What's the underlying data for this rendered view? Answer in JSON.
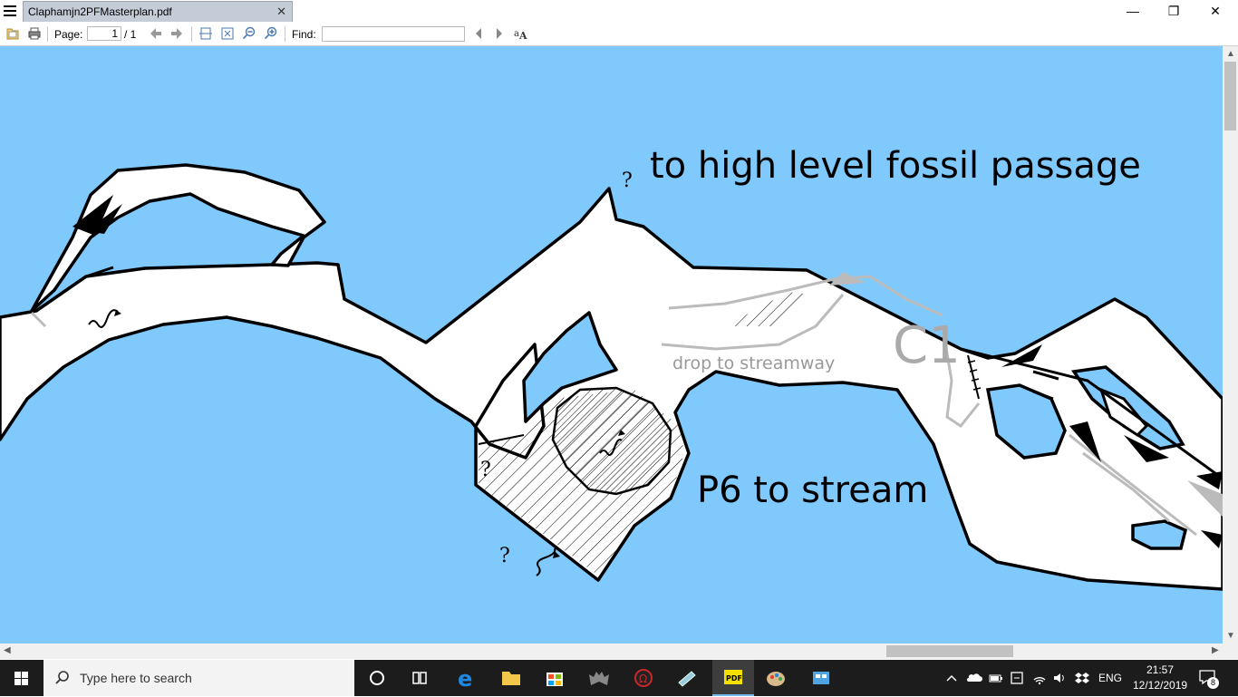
{
  "window": {
    "tab_title": "Claphamjn2PFMasterplan.pdf",
    "tab_close": "✕",
    "minimize": "—",
    "restore": "❐",
    "close": "✕"
  },
  "toolbar": {
    "page_label": "Page:",
    "page_value": "1",
    "page_total": "/ 1",
    "find_label": "Find:",
    "find_value": ""
  },
  "document": {
    "label_fossil": "to high level fossil passage",
    "label_p6": "P6 to stream",
    "label_drop": "drop to streamway",
    "label_c1": "C1",
    "question_marks": [
      "?",
      "?",
      "?"
    ],
    "colors": {
      "water": "#80c9fd",
      "passage": "#ffffff",
      "outline": "#000000",
      "faint": "#bbbbbb"
    }
  },
  "taskbar": {
    "search_placeholder": "Type here to search",
    "language": "ENG",
    "time": "21:57",
    "date": "12/12/2019",
    "notification_count": "8",
    "apps": [
      "task-view",
      "edge",
      "file-explorer",
      "store",
      "bat-app",
      "omega-app",
      "notes-app",
      "pdf-app",
      "paint-app",
      "control-app"
    ]
  }
}
